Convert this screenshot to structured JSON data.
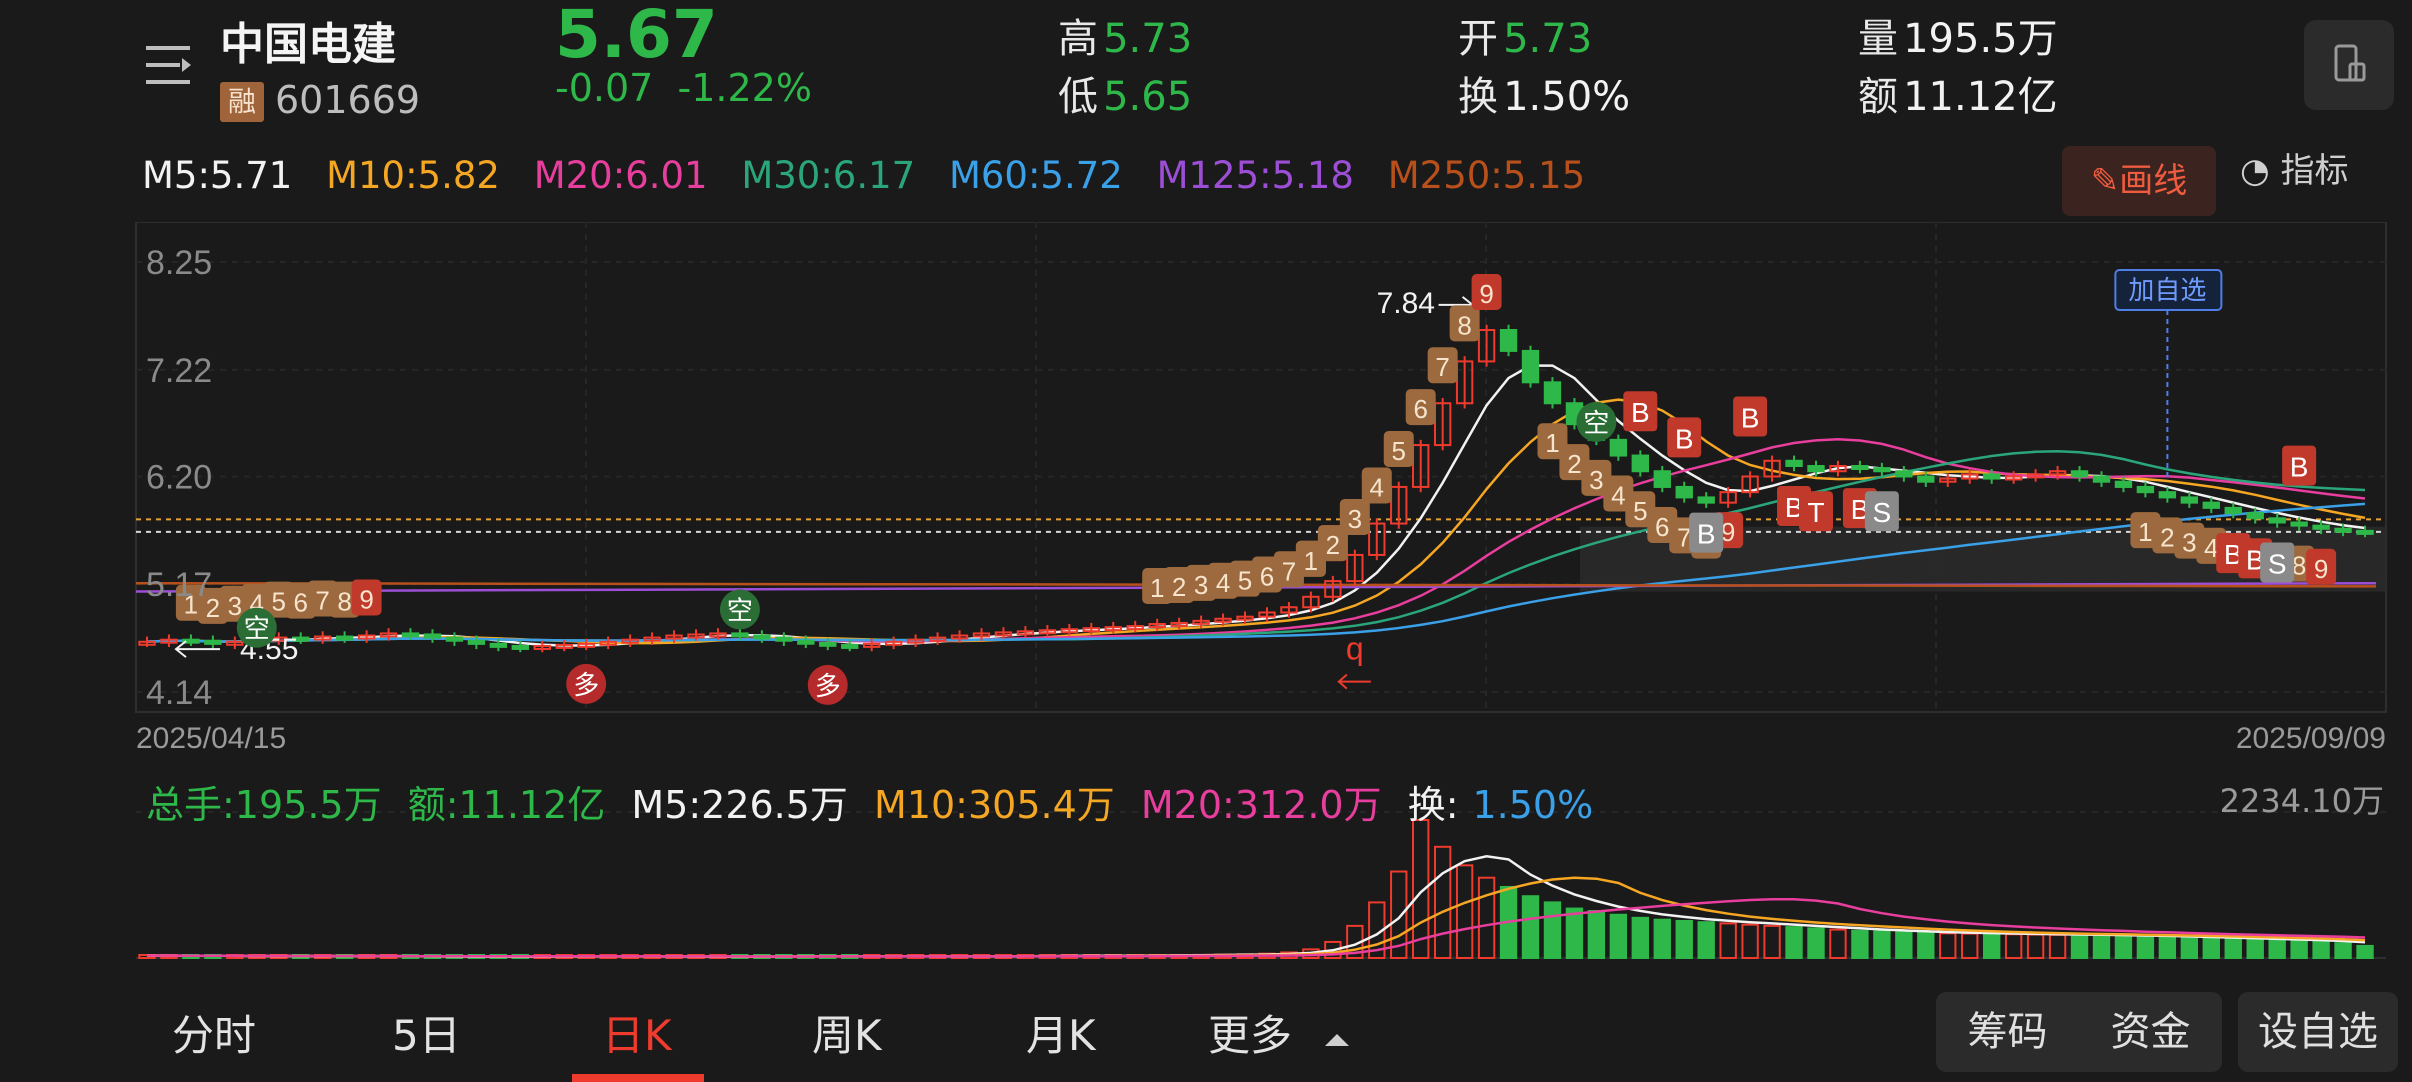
{
  "header": {
    "stock_name": "中国电建",
    "margin_badge": "融",
    "stock_code": "601669",
    "price": "5.67",
    "change": "-0.07",
    "change_pct": "-1.22%",
    "high_label": "高",
    "high": "5.73",
    "low_label": "低",
    "low": "5.65",
    "open_label": "开",
    "open": "5.73",
    "turnover_label": "换",
    "turnover": "1.50%",
    "volume_label": "量",
    "volume": "195.5万",
    "amount_label": "额",
    "amount": "11.12亿"
  },
  "ma_labels": [
    {
      "text": "M5:5.71",
      "color": "#f2f2f2"
    },
    {
      "text": "M10:5.82",
      "color": "#f5a623"
    },
    {
      "text": "M20:6.01",
      "color": "#e83e9d"
    },
    {
      "text": "M30:6.17",
      "color": "#2aa67a"
    },
    {
      "text": "M60:5.72",
      "color": "#3aa0e8"
    },
    {
      "text": "M125:5.18",
      "color": "#9c4fd6"
    },
    {
      "text": "M250:5.15",
      "color": "#b8501c"
    }
  ],
  "toolbar": {
    "draw_label": "画线",
    "indicator_label": "指标"
  },
  "chart_data": {
    "type": "candlestick",
    "y_ticks": [
      "8.25",
      "7.22",
      "6.20",
      "5.17",
      "4.14"
    ],
    "ylim": [
      4.14,
      8.25
    ],
    "x_start": "2025/04/15",
    "x_end": "2025/09/09",
    "max_annotation": "7.84",
    "min_annotation": "4.55",
    "add_watchlist_tag": "加自选",
    "closes": [
      4.62,
      4.64,
      4.63,
      4.6,
      4.62,
      4.64,
      4.66,
      4.65,
      4.67,
      4.66,
      4.68,
      4.7,
      4.69,
      4.66,
      4.63,
      4.6,
      4.58,
      4.57,
      4.58,
      4.59,
      4.6,
      4.62,
      4.64,
      4.66,
      4.68,
      4.69,
      4.7,
      4.68,
      4.66,
      4.63,
      4.61,
      4.59,
      4.58,
      4.6,
      4.62,
      4.64,
      4.66,
      4.68,
      4.7,
      4.71,
      4.72,
      4.73,
      4.74,
      4.75,
      4.76,
      4.77,
      4.79,
      4.8,
      4.82,
      4.84,
      4.86,
      4.9,
      4.95,
      5.05,
      5.2,
      5.45,
      5.75,
      6.1,
      6.5,
      6.9,
      7.3,
      7.6,
      7.4,
      7.1,
      6.9,
      6.7,
      6.55,
      6.4,
      6.25,
      6.1,
      6.0,
      5.95,
      6.05,
      6.2,
      6.35,
      6.3,
      6.25,
      6.3,
      6.28,
      6.25,
      6.2,
      6.15,
      6.18,
      6.22,
      6.18,
      6.2,
      6.22,
      6.25,
      6.2,
      6.15,
      6.1,
      6.05,
      6.0,
      5.95,
      5.9,
      5.85,
      5.8,
      5.76,
      5.73,
      5.7,
      5.68,
      5.67
    ],
    "volume_max_label": "2234.10万",
    "volumes": [
      40,
      38,
      35,
      32,
      30,
      28,
      30,
      32,
      34,
      30,
      28,
      26,
      25,
      24,
      22,
      20,
      22,
      24,
      26,
      28,
      30,
      28,
      26,
      24,
      22,
      20,
      22,
      24,
      26,
      28,
      30,
      32,
      30,
      28,
      26,
      24,
      22,
      26,
      28,
      30,
      32,
      34,
      36,
      38,
      40,
      42,
      44,
      48,
      50,
      55,
      60,
      70,
      90,
      140,
      260,
      520,
      900,
      1400,
      2234,
      1800,
      1500,
      1300,
      1150,
      1000,
      900,
      800,
      760,
      700,
      650,
      620,
      600,
      580,
      560,
      540,
      520,
      500,
      480,
      460,
      440,
      430,
      420,
      410,
      400,
      395,
      390,
      385,
      380,
      375,
      370,
      365,
      360,
      350,
      340,
      330,
      320,
      310,
      300,
      290,
      280,
      270,
      240,
      195.5
    ],
    "signals": {
      "buy": "B",
      "sell": "S",
      "long": "多",
      "short": "空",
      "trade": "T",
      "q": "q"
    },
    "sequence_counts": [
      "1",
      "2",
      "3",
      "4",
      "5",
      "6",
      "7",
      "8",
      "9"
    ]
  },
  "volume_stats": [
    {
      "text": "总手:195.5万",
      "color": "#2fb84a"
    },
    {
      "text": "额:11.12亿",
      "color": "#2fb84a"
    },
    {
      "text": "M5:226.5万",
      "color": "#f2f2f2"
    },
    {
      "text": "M10:305.4万",
      "color": "#f5a623"
    },
    {
      "text": "M20:312.0万",
      "color": "#e83e9d"
    },
    {
      "label": "换:",
      "value": "1.50%",
      "color": "#3aa0e8"
    }
  ],
  "tabs": [
    {
      "label": "分时",
      "active": false
    },
    {
      "label": "5日",
      "active": false
    },
    {
      "label": "日K",
      "active": true
    },
    {
      "label": "周K",
      "active": false
    },
    {
      "label": "月K",
      "active": false
    },
    {
      "label": "更多",
      "active": false
    }
  ],
  "actions": {
    "chips": "筹码",
    "funds": "资金",
    "add_watchlist": "设自选"
  },
  "colors": {
    "up": "#ef3b2d",
    "down": "#2fb84a",
    "background": "#1a1a1a",
    "accent": "#ef3b2d"
  }
}
